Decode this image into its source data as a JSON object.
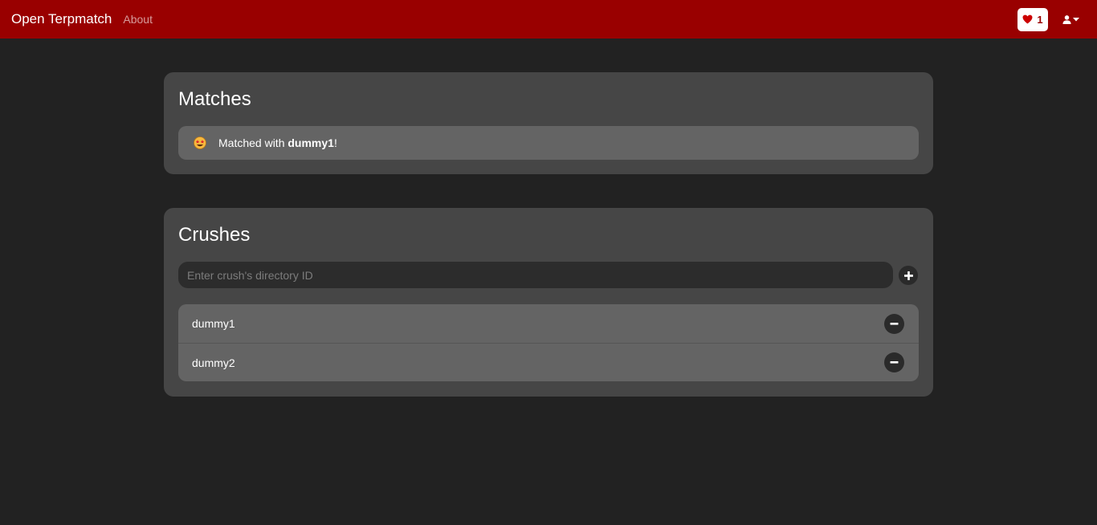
{
  "navbar": {
    "brand": "Open Terpmatch",
    "about_link": "About",
    "match_count": "1",
    "heart_icon": "heart-icon",
    "user_icon": "user-icon",
    "colors": {
      "background": "#990000",
      "badge_bg": "#ffffff"
    }
  },
  "matches": {
    "title": "Matches",
    "items": [
      {
        "icon": "star-struck-emoji-icon",
        "prefix": "Matched with ",
        "name": "dummy1",
        "suffix": "!"
      }
    ]
  },
  "crushes": {
    "title": "Crushes",
    "input": {
      "placeholder": "Enter crush's directory ID",
      "value": ""
    },
    "add_icon": "plus-icon",
    "items": [
      {
        "name": "dummy1",
        "remove_icon": "minus-icon"
      },
      {
        "name": "dummy2",
        "remove_icon": "minus-icon"
      }
    ]
  },
  "colors": {
    "page_bg": "#222222",
    "card_bg": "#464646",
    "item_bg": "#646464"
  }
}
